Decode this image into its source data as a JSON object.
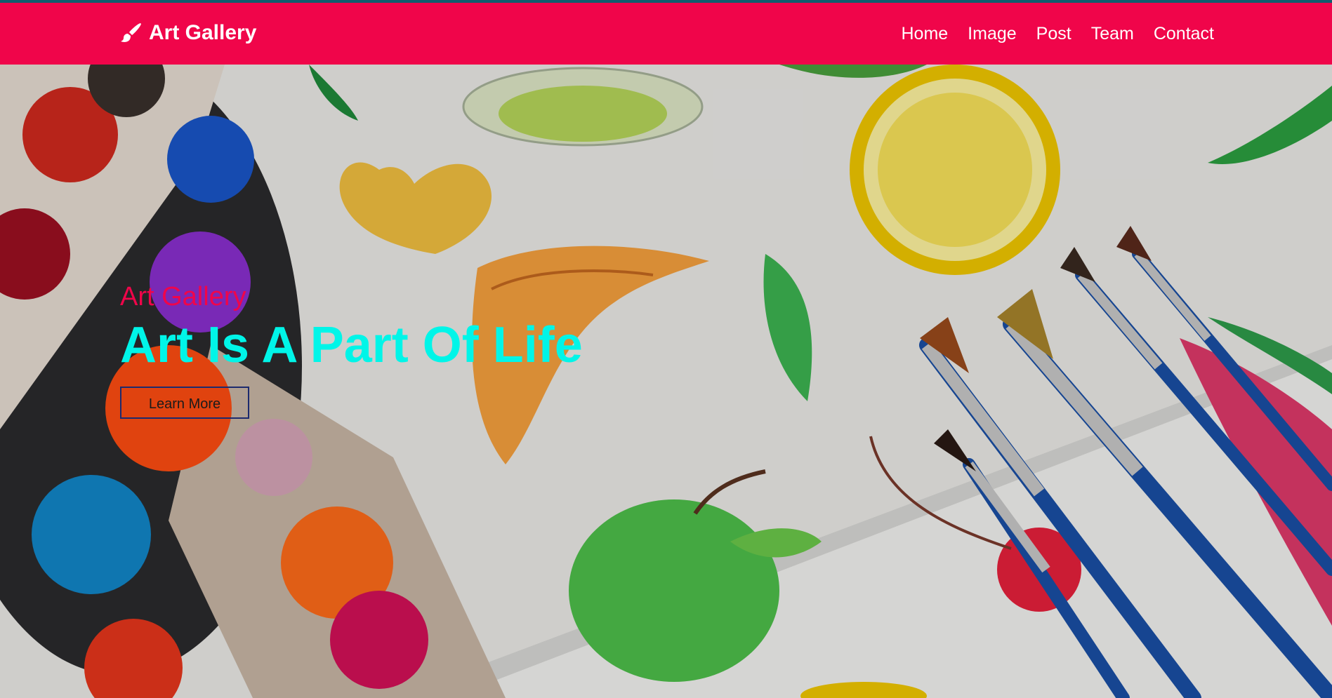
{
  "navbar": {
    "brand": "Art Gallery",
    "brand_icon": "paintbrush-icon",
    "links": [
      "Home",
      "Image",
      "Post",
      "Team",
      "Contact"
    ]
  },
  "hero": {
    "subtitle": "Art Gallery",
    "title": "Art Is A Part Of Life",
    "button_label": "Learn More",
    "background_image": "watercolor palette, paint brushes and fruit sketches"
  },
  "colors": {
    "navbar_bg": "#f0054a",
    "subtitle": "#f0054a",
    "title": "#00f5e8",
    "top_line": "#0f5d6e"
  }
}
